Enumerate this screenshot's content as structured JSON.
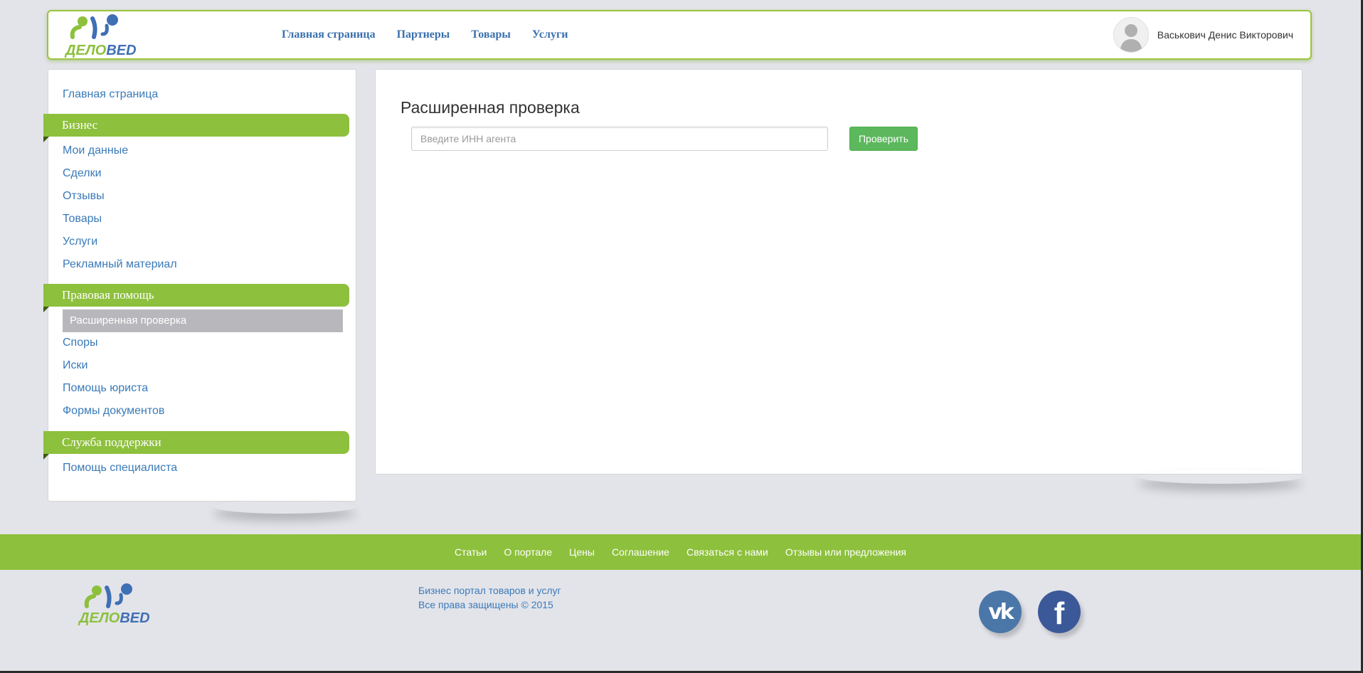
{
  "colors": {
    "accent_green": "#8dc03c",
    "link_blue": "#3a7ab8",
    "button_green": "#5cb85c",
    "vk_blue": "#4a76a8",
    "fb_blue": "#3b5998",
    "active_gray": "#b8b8bc"
  },
  "logo": {
    "text_part1": "ДЕЛО",
    "text_part2": "BED"
  },
  "header": {
    "nav": [
      "Главная страница",
      "Партнеры",
      "Товары",
      "Услуги"
    ],
    "user_name": "Васькович Денис Викторович",
    "avatar_icon": "user-silhouette-icon"
  },
  "sidebar": {
    "home": "Главная страница",
    "sections": [
      {
        "title": "Бизнес",
        "items": [
          "Мои данные",
          "Сделки",
          "Отзывы",
          "Товары",
          "Услуги",
          "Рекламный материал"
        ]
      },
      {
        "title": "Правовая помощь",
        "active_item": "Расширенная проверка",
        "items": [
          "Споры",
          "Иски",
          "Помощь юриста",
          "Формы документов"
        ]
      },
      {
        "title": "Служба поддержки",
        "items": [
          "Помощь специалиста"
        ]
      }
    ]
  },
  "main": {
    "title": "Расширенная проверка",
    "inn_placeholder": "Введите ИНН агента",
    "inn_value": "",
    "check_button": "Проверить"
  },
  "footer": {
    "links": [
      "Статьи",
      "О портале",
      "Цены",
      "Соглашение",
      "Связаться с нами",
      "Отзывы или предложения"
    ],
    "tagline": "Бизнес портал товаров и услуг",
    "copyright": "Все права защищены © 2015",
    "social": [
      {
        "name": "vk-icon",
        "glyph": "vk"
      },
      {
        "name": "facebook-icon",
        "glyph": "f"
      }
    ]
  }
}
